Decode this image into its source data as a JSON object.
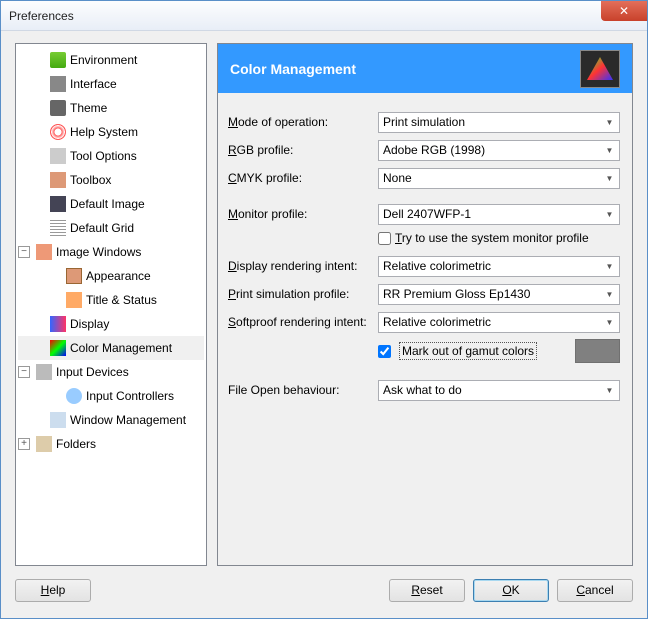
{
  "window": {
    "title": "Preferences",
    "close": "✕"
  },
  "sidebar": {
    "items": [
      {
        "label": "Environment",
        "indent": 14,
        "toggle": "",
        "icon": "ico-env"
      },
      {
        "label": "Interface",
        "indent": 14,
        "toggle": "",
        "icon": "ico-interface"
      },
      {
        "label": "Theme",
        "indent": 14,
        "toggle": "",
        "icon": "ico-theme"
      },
      {
        "label": "Help System",
        "indent": 14,
        "toggle": "",
        "icon": "ico-help"
      },
      {
        "label": "Tool Options",
        "indent": 14,
        "toggle": "",
        "icon": "ico-tool"
      },
      {
        "label": "Toolbox",
        "indent": 14,
        "toggle": "",
        "icon": "ico-toolbox"
      },
      {
        "label": "Default Image",
        "indent": 14,
        "toggle": "",
        "icon": "ico-defimg"
      },
      {
        "label": "Default Grid",
        "indent": 14,
        "toggle": "",
        "icon": "ico-grid"
      },
      {
        "label": "Image Windows",
        "indent": 0,
        "toggle": "−",
        "icon": "ico-imgwin"
      },
      {
        "label": "Appearance",
        "indent": 30,
        "toggle": "",
        "icon": "ico-appear"
      },
      {
        "label": "Title & Status",
        "indent": 30,
        "toggle": "",
        "icon": "ico-title"
      },
      {
        "label": "Display",
        "indent": 14,
        "toggle": "",
        "icon": "ico-display"
      },
      {
        "label": "Color Management",
        "indent": 14,
        "toggle": "",
        "icon": "ico-color",
        "selected": true
      },
      {
        "label": "Input Devices",
        "indent": 0,
        "toggle": "−",
        "icon": "ico-input"
      },
      {
        "label": "Input Controllers",
        "indent": 30,
        "toggle": "",
        "icon": "ico-controllers"
      },
      {
        "label": "Window Management",
        "indent": 14,
        "toggle": "",
        "icon": "ico-winmgmt"
      },
      {
        "label": "Folders",
        "indent": 0,
        "toggle": "+",
        "icon": "ico-folders"
      }
    ]
  },
  "panel": {
    "title": "Color Management",
    "fields": {
      "mode_label_pre": "M",
      "mode_label_post": "ode of operation:",
      "mode_value": "Print simulation",
      "rgb_label_pre": "R",
      "rgb_label_post": "GB profile:",
      "rgb_value": "Adobe RGB (1998)",
      "cmyk_label_pre": "C",
      "cmyk_label_post": "MYK profile:",
      "cmyk_value": "None",
      "monitor_label_pre": "M",
      "monitor_label_post": "onitor profile:",
      "monitor_value": "Dell 2407WFP-1",
      "sysmon_pre": "T",
      "sysmon_post": "ry to use the system monitor profile",
      "dri_pre": "D",
      "dri_post": "isplay rendering intent:",
      "dri_value": "Relative colorimetric",
      "psp_pre": "P",
      "psp_post": "rint simulation profile:",
      "psp_value": "RR Premium Gloss Ep1430",
      "sri_pre": "S",
      "sri_post": "oftproof rendering intent:",
      "sri_value": "Relative colorimetric",
      "gamut_label": "Mark out of gamut colors",
      "fob_pre": "File O",
      "fob_mid": "pen behaviour:",
      "fob_value": "Ask what to do"
    }
  },
  "footer": {
    "help_u": "H",
    "help_rest": "elp",
    "reset_u": "R",
    "reset_rest": "eset",
    "ok_u": "O",
    "ok_rest": "K",
    "cancel_u": "C",
    "cancel_rest": "ancel"
  }
}
